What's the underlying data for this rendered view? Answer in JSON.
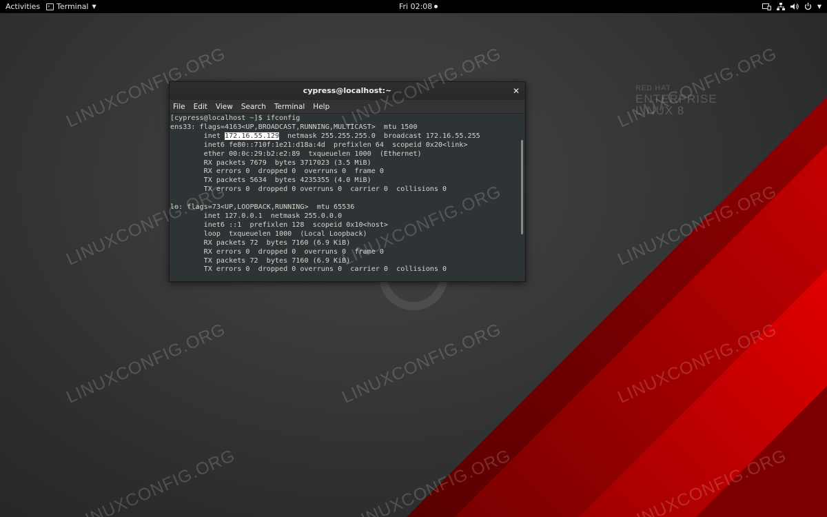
{
  "topbar": {
    "activities": "Activities",
    "app_name": "Terminal",
    "clock": "Fri 02:08",
    "tray_icons": [
      "screen-icon",
      "network-icon",
      "volume-icon",
      "power-icon"
    ]
  },
  "wallpaper": {
    "logo_line1": "RED HAT",
    "logo_line2": "ENTERPRISE",
    "logo_line3": "LINUX 8",
    "stripe_colors": [
      "#b30000",
      "#8a0000",
      "#e00000"
    ]
  },
  "watermark": "LINUXCONFIG.ORG",
  "terminal": {
    "title": "cypress@localhost:~",
    "menu": [
      "File",
      "Edit",
      "View",
      "Search",
      "Terminal",
      "Help"
    ],
    "lines": [
      "[cypress@localhost ~]$ ifconfig",
      "ens33: flags=4163<UP,BROADCAST,RUNNING,MULTICAST>  mtu 1500",
      "        inet ",
      "        inet6 fe80::710f:1e21:d18a:4d  prefixlen 64  scopeid 0x20<link>",
      "        ether 00:0c:29:b2:e2:89  txqueuelen 1000  (Ethernet)",
      "        RX packets 7679  bytes 3717023 (3.5 MiB)",
      "        RX errors 0  dropped 0  overruns 0  frame 0",
      "        TX packets 5634  bytes 4235355 (4.0 MiB)",
      "        TX errors 0  dropped 0 overruns 0  carrier 0  collisions 0",
      "",
      "lo: flags=73<UP,LOOPBACK,RUNNING>  mtu 65536",
      "        inet 127.0.0.1  netmask 255.0.0.0",
      "        inet6 ::1  prefixlen 128  scopeid 0x10<host>",
      "        loop  txqueuelen 1000  (Local Loopback)",
      "        RX packets 72  bytes 7160 (6.9 KiB)",
      "        RX errors 0  dropped 0  overruns 0  frame 0",
      "        TX packets 72  bytes 7160 (6.9 KiB)",
      "        TX errors 0  dropped 0 overruns 0  carrier 0  collisions 0"
    ],
    "highlighted_ip": "172.16.55.129",
    "inet_rest": "  netmask 255.255.255.0  broadcast 172.16.55.255"
  }
}
